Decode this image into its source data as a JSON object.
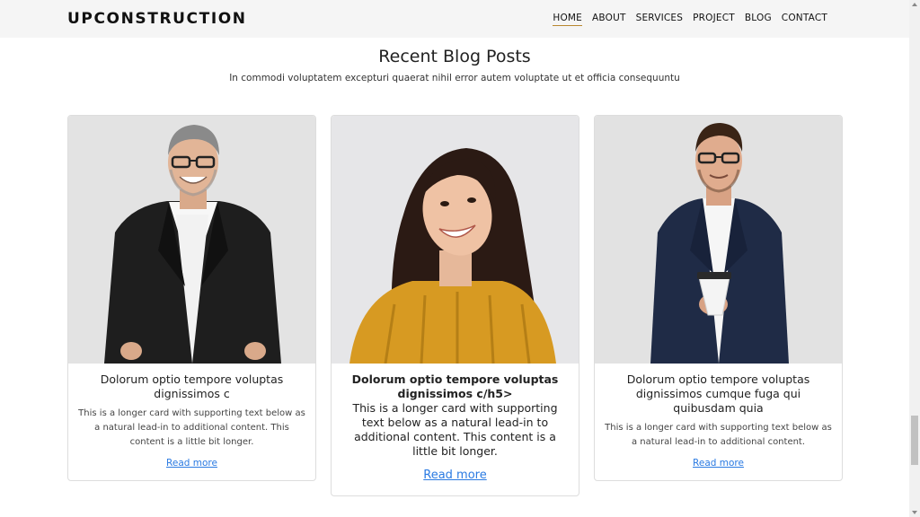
{
  "header": {
    "brand": "UPCONSTRUCTION",
    "nav": [
      {
        "label": "HOME",
        "active": true
      },
      {
        "label": "ABOUT"
      },
      {
        "label": "SERVICES"
      },
      {
        "label": "PROJECT"
      },
      {
        "label": "BLOG"
      },
      {
        "label": "CONTACT"
      }
    ]
  },
  "section": {
    "title": "Recent Blog Posts",
    "subtitle": "In commodi voluptatem excepturi quaerat nihil error autem voluptate ut et officia consequuntu"
  },
  "cards": [
    {
      "title": "Dolorum optio tempore voluptas dignissimos c",
      "text": "This is a longer card with supporting text below as a natural lead-in to additional content. This content is a little bit longer.",
      "link": "Read more"
    },
    {
      "title": "Dolorum optio tempore voluptas dignissimos c/h5>",
      "text": "This is a longer card with supporting text below as a natural lead-in to additional content. This content is a little bit longer.",
      "link": "Read more"
    },
    {
      "title": "Dolorum optio tempore voluptas dignissimos cumque fuga qui quibusdam quia",
      "text": "This is a longer card with supporting text below as a natural lead-in to additional content.",
      "link": "Read more"
    }
  ],
  "colors": {
    "accent": "#b8872f",
    "link": "#2a7ae2",
    "navbar_bg": "#f5f5f5"
  }
}
